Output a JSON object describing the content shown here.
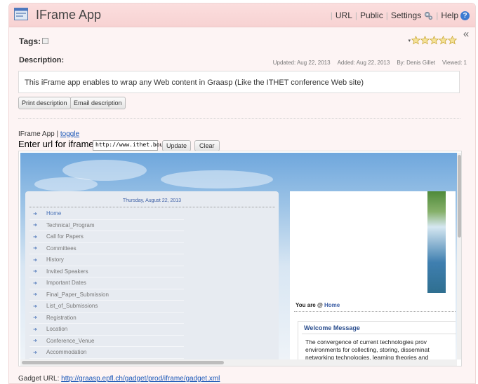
{
  "header": {
    "title": "IFrame App",
    "nav": [
      "URL",
      "Public",
      "Settings",
      "Help"
    ],
    "help_glyph": "?"
  },
  "collapse_glyph": "«",
  "tags": {
    "label": "Tags:"
  },
  "rating": {
    "stars": 5,
    "arrow_glyph": "▾"
  },
  "description": {
    "label": "Description:",
    "updated": "Updated:  Aug 22, 2013",
    "added": "Added:  Aug 22, 2013",
    "by": "By:  Denis Gillet",
    "viewed": "Viewed:  1",
    "text": "This iFrame app enables to wrap any Web content in Graasp (Like the ITHET conference Web site)",
    "print_button": "Print description",
    "email_button": "Email description"
  },
  "iframe_app": {
    "label": "IFrame App",
    "toggle": "toggle",
    "url_label": "Enter url for iframe:",
    "url_value": "http://www.ithet.bour",
    "update_button": "Update",
    "clear_button": "Clear"
  },
  "site": {
    "date": "Thursday, August 22, 2013",
    "arrow_glyph": "➜",
    "menu": [
      "Home",
      "Technical_Program",
      "Call for Papers",
      "Committees",
      "History",
      "Invited Speakers",
      "Important Dates",
      "Final_Paper_Submission",
      "List_of_Submissions",
      "Registration",
      "Location",
      "Conference_Venue",
      "Accommodation"
    ],
    "you_are": "You are @",
    "you_are_link": "Home",
    "welcome_title": "Welcome Message",
    "welcome_text": "  The convergence of current technologies prov\nenvironments for collecting, storing, disseminat\nnetworking technologies, learning theories and"
  },
  "gadget": {
    "label": "Gadget URL:",
    "url": "http://graasp.epfl.ch/gadget/prod/iframe/gadget.xml"
  }
}
